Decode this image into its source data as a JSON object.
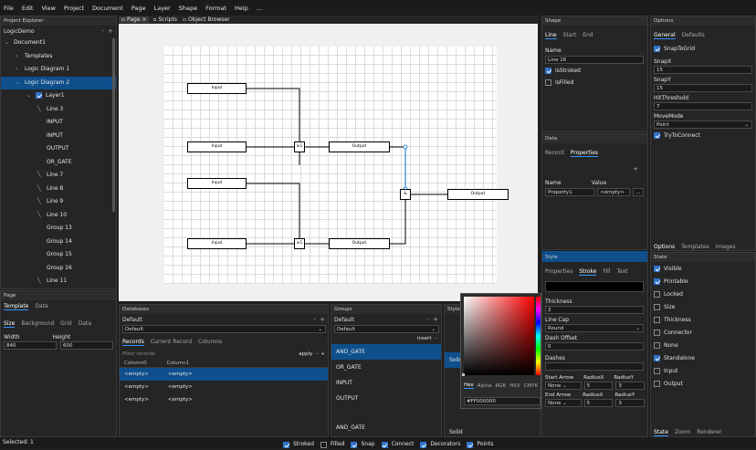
{
  "menu": [
    "File",
    "Edit",
    "View",
    "Project",
    "Document",
    "Page",
    "Layer",
    "Shape",
    "Format",
    "Help",
    "…"
  ],
  "doc_tabs": [
    {
      "label": "Page"
    },
    {
      "label": "Scripts"
    },
    {
      "label": "Object Browser"
    }
  ],
  "project_explorer": {
    "title": "Project Explorer",
    "project": "LogicDemo",
    "items": [
      {
        "label": "Document1",
        "indent": 0
      },
      {
        "label": "Templates",
        "indent": 1
      },
      {
        "label": "Logic Diagram 1",
        "indent": 1
      },
      {
        "label": "Logic Diagram 2",
        "indent": 1
      },
      {
        "label": "Layer1",
        "indent": 2
      },
      {
        "label": "Line 3",
        "indent": 3
      },
      {
        "label": "INPUT",
        "indent": 3
      },
      {
        "label": "INPUT",
        "indent": 3
      },
      {
        "label": "OUTPUT",
        "indent": 3
      },
      {
        "label": "OR_GATE",
        "indent": 3
      },
      {
        "label": "Line 7",
        "indent": 3
      },
      {
        "label": "Line 8",
        "indent": 3
      },
      {
        "label": "Line 9",
        "indent": 3
      },
      {
        "label": "Line 10",
        "indent": 3
      },
      {
        "label": "Group 13",
        "indent": 3
      },
      {
        "label": "Group 14",
        "indent": 3
      },
      {
        "label": "Group 15",
        "indent": 3
      },
      {
        "label": "Group 16",
        "indent": 3
      },
      {
        "label": "Line 11",
        "indent": 3
      }
    ]
  },
  "page_panel": {
    "title": "Page",
    "tabs": [
      "Template",
      "Data"
    ],
    "subtabs": [
      "Size",
      "Background",
      "Grid",
      "Data"
    ],
    "width_label": "Width",
    "height_label": "Height",
    "width": "840",
    "height": "600"
  },
  "diagram": {
    "input_label": "Input",
    "output_label": "Output",
    "or_label": "≥1",
    "and_label": "&"
  },
  "databases": {
    "title": "Databases",
    "selected": "Default",
    "db": "Default",
    "tabs": [
      "Records",
      "Current Record",
      "Columns"
    ],
    "filter_placeholder": "Filter records",
    "apply": "apply",
    "col0": "Column0",
    "col1": "Column1",
    "cell": "<empty>"
  },
  "groups": {
    "title": "Groups",
    "selected": "Default",
    "insert": "insert",
    "items": [
      "AND_GATE",
      "OR_GATE",
      "INPUT",
      "OUTPUT",
      "AND_GATE"
    ]
  },
  "styles": {
    "title": "Styles",
    "items": [
      "Solid",
      "Solid"
    ]
  },
  "picker": {
    "tabs": [
      "Hex",
      "Alpha",
      "RGB",
      "HSV",
      "CMYK"
    ],
    "hex": "#FF000000"
  },
  "shape": {
    "title": "Shape",
    "tabs": [
      "Line",
      "Start",
      "End"
    ],
    "name_label": "Name",
    "name": "Line 16",
    "stroked": "IsStroked",
    "filled": "IsFilled"
  },
  "data_panel": {
    "title": "Data",
    "tabs": [
      "Record",
      "Properties"
    ],
    "name_label": "Name",
    "value_label": "Value",
    "prop_name": "Property1",
    "prop_value": "<empty>",
    "more": "..."
  },
  "style_panel": {
    "title": "Style",
    "tabs": [
      "Properties",
      "Stroke",
      "Fill",
      "Text"
    ],
    "thickness_label": "Thickness",
    "thickness": "2",
    "linecap_label": "Line Cap",
    "linecap": "Round",
    "dashoffset_label": "Dash Offset",
    "dashoffset": "0",
    "dashes_label": "Dashes",
    "start_arrow": "Start Arrow",
    "end_arrow": "End Arrow",
    "radx": "RadiusX",
    "rady": "RadiusY",
    "none": "None",
    "rx": "5",
    "ry": "3"
  },
  "options": {
    "title": "Options",
    "tabs": [
      "General",
      "Defaults"
    ],
    "snap": "SnapToGrid",
    "snapx_label": "SnapX",
    "snapx": "15",
    "snapy_label": "SnapY",
    "snapy": "15",
    "hit_label": "HitThreshold",
    "hit": "7",
    "move_label": "MoveMode",
    "move": "Point",
    "connect": "TryToConnect",
    "btabs": [
      "Options",
      "Templates",
      "Images"
    ]
  },
  "state": {
    "title": "State",
    "items": [
      {
        "label": "Visible",
        "on": true
      },
      {
        "label": "Printable",
        "on": true
      },
      {
        "label": "Locked",
        "on": false
      },
      {
        "label": "Size",
        "on": false
      },
      {
        "label": "Thickness",
        "on": false
      },
      {
        "label": "Connector",
        "on": false
      },
      {
        "label": "None",
        "on": false
      },
      {
        "label": "Standalone",
        "on": true
      },
      {
        "label": "Input",
        "on": false
      },
      {
        "label": "Output",
        "on": false
      }
    ],
    "btabs": [
      "State",
      "Zoom",
      "Renderer"
    ]
  },
  "status": {
    "selected": "Selected: 1",
    "flags": [
      {
        "label": "Stroked",
        "on": true
      },
      {
        "label": "Filled",
        "on": false
      },
      {
        "label": "Snap",
        "on": true
      },
      {
        "label": "Connect",
        "on": true
      },
      {
        "label": "Decorators",
        "on": true
      },
      {
        "label": "Points",
        "on": true
      }
    ]
  },
  "colors": {
    "accent": "#0e4f8c",
    "check": "#2f73c9"
  }
}
